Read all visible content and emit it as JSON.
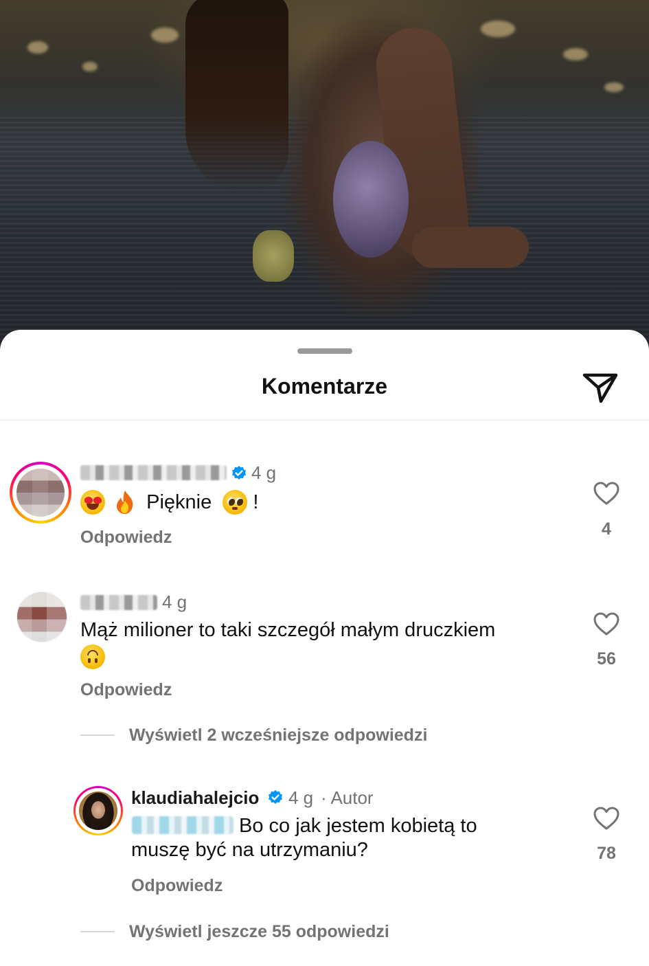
{
  "sheet": {
    "title": "Komentarze",
    "share_icon": "paper-plane-icon"
  },
  "comments": [
    {
      "username": "",
      "username_hidden": true,
      "verified": true,
      "time": "4 g",
      "text": "Pięknie",
      "text_suffix": "!",
      "emojis": [
        "heart-eyes-emoji",
        "fire-emoji",
        "pleading-face-emoji"
      ],
      "reply_label": "Odpowiedz",
      "likes": "4"
    },
    {
      "username": "",
      "username_hidden": true,
      "verified": false,
      "time": "4 g",
      "text": "Mąż milioner to taki szczegół małym druczkiem",
      "emojis": [
        "upside-down-face-emoji"
      ],
      "reply_label": "Odpowiedz",
      "likes": "56",
      "view_replies": "Wyświetl 2 wcześniejsze odpowiedzi",
      "replies": [
        {
          "username": "klaudiahalejcio",
          "verified": true,
          "time": "4 g",
          "author_label": "· Autor",
          "mention_hidden": true,
          "text_line1": "Bo co jak jestem kobietą to",
          "text_line2": "muszę być na utrzymaniu?",
          "reply_label": "Odpowiedz",
          "likes": "78"
        }
      ],
      "more_replies": "Wyświetl jeszcze 55 odpowiedzi"
    }
  ],
  "colors": {
    "verified_blue": "#0095f6",
    "muted_text": "#737373",
    "story_ring": [
      "#d300c5",
      "#ff0069",
      "#ffd600"
    ]
  }
}
